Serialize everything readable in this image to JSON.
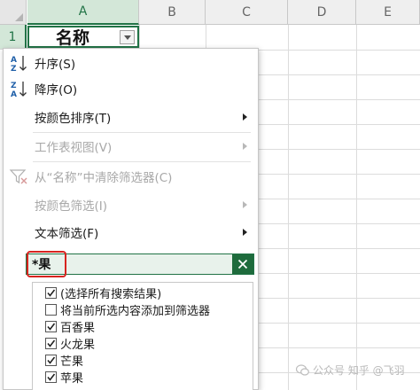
{
  "sheet": {
    "columns": [
      "A",
      "B",
      "C",
      "D",
      "E"
    ],
    "rows": [
      "1"
    ],
    "cell_a1": "名称"
  },
  "menu": {
    "sort_asc": "升序(S)",
    "sort_desc": "降序(O)",
    "sort_by_color": "按颜色排序(T)",
    "sheet_view": "工作表视图(V)",
    "clear_filter": "从“名称”中清除筛选器(C)",
    "filter_by_color": "按颜色筛选(I)",
    "text_filter": "文本筛选(F)"
  },
  "search": {
    "value": "*果"
  },
  "list": {
    "items": [
      {
        "label": "(选择所有搜索结果)",
        "checked": true
      },
      {
        "label": "将当前所选内容添加到筛选器",
        "checked": false
      },
      {
        "label": "百香果",
        "checked": true
      },
      {
        "label": "火龙果",
        "checked": true
      },
      {
        "label": "芒果",
        "checked": true
      },
      {
        "label": "苹果",
        "checked": true
      }
    ]
  },
  "watermark": "公众号 知乎 @飞羽"
}
